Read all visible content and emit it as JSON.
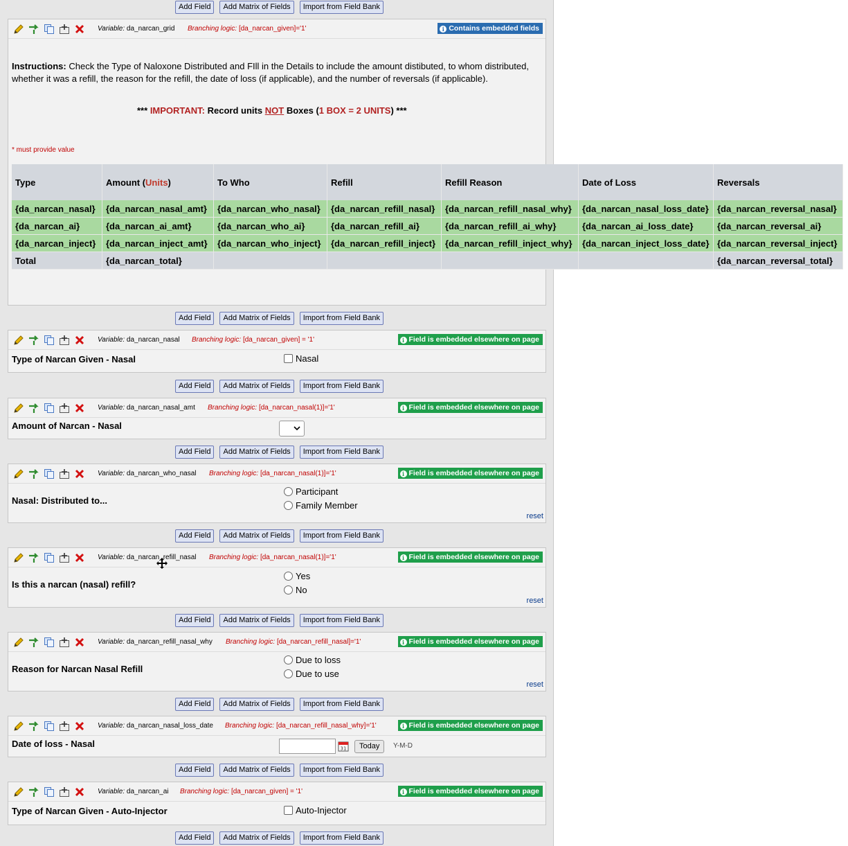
{
  "buttons": {
    "add_field": "Add Field",
    "add_matrix": "Add Matrix of Fields",
    "import": "Import from Field Bank"
  },
  "labels": {
    "variable": "Variable:",
    "branching": "Branching logic:",
    "reset": "reset",
    "today": "Today",
    "date_format": "Y-M-D"
  },
  "badges": {
    "embedded_elsewhere": "Field is embedded elsewhere on page",
    "contains_embedded": "Contains embedded fields"
  },
  "colors": {
    "badge_green": "#1f9f4b",
    "badge_blue": "#2a6cb0",
    "branching_red": "#c00000",
    "matrix_row_green": "#a9d9a0",
    "header_grey": "#d3d7dd"
  },
  "grid": {
    "variable": "da_narcan_grid",
    "branching": "[da_narcan_given]='1'",
    "instructions_bold": "Instructions:",
    "instructions_text": "Check the Type of Naloxone Distributed and FIll in the Details to include the amount distibuted, to whom distributed, whether it was a refill, the reason for the refill,  the date of loss (if applicable), and the number of reversals (if applicable).",
    "important": {
      "stars_left": "***",
      "important": "IMPORTANT:",
      "record_units": "Record units",
      "not": "NOT",
      "boxes": "Boxes (",
      "ratio": "1 BOX = 2 UNITS",
      "close": ")",
      "stars_right": "***"
    },
    "must_provide": "* must provide value",
    "headers": [
      "Type",
      "Amount (",
      "Units",
      ")",
      "To Who",
      "Refill",
      "Refill Reason",
      "Date of Loss",
      "Reversals"
    ],
    "rows": [
      [
        "{da_narcan_nasal}",
        "{da_narcan_nasal_amt}",
        "{da_narcan_who_nasal}",
        "{da_narcan_refill_nasal}",
        "{da_narcan_refill_nasal_why}",
        "{da_narcan_nasal_loss_date}",
        "{da_narcan_reversal_nasal}"
      ],
      [
        "{da_narcan_ai}",
        "{da_narcan_ai_amt}",
        "{da_narcan_who_ai}",
        "{da_narcan_refill_ai}",
        "{da_narcan_refill_ai_why}",
        "{da_narcan_ai_loss_date}",
        "{da_narcan_reversal_ai}"
      ],
      [
        "{da_narcan_inject}",
        "{da_narcan_inject_amt}",
        "{da_narcan_who_inject}",
        "{da_narcan_refill_inject}",
        "{da_narcan_refill_inject_why}",
        "{da_narcan_inject_loss_date}",
        "{da_narcan_reversal_inject}"
      ]
    ],
    "total_row": [
      "Total",
      "{da_narcan_total}",
      "",
      "",
      "",
      "",
      "{da_narcan_reversal_total}"
    ]
  },
  "fields": [
    {
      "variable": "da_narcan_nasal",
      "branching": "[da_narcan_given] = '1'",
      "label": "Type of Narcan Given - Nasal",
      "choices": [
        "Nasal"
      ]
    },
    {
      "variable": "da_narcan_nasal_amt",
      "branching": "[da_narcan_nasal(1)]='1'",
      "label": "Amount of Narcan - Nasal",
      "choices": []
    },
    {
      "variable": "da_narcan_who_nasal",
      "branching": "[da_narcan_nasal(1)]='1'",
      "label": "Nasal: Distributed to...",
      "choices": [
        "Participant",
        "Family Member"
      ]
    },
    {
      "variable": "da_narcan_refill_nasal",
      "branching": "[da_narcan_nasal(1)]='1'",
      "label": "Is this a narcan (nasal) refill?",
      "choices": [
        "Yes",
        "No"
      ]
    },
    {
      "variable": "da_narcan_refill_nasal_why",
      "branching": "[da_narcan_refill_nasal]='1'",
      "label": "Reason for Narcan Nasal Refill",
      "choices": [
        "Due to loss",
        "Due to use"
      ]
    },
    {
      "variable": "da_narcan_nasal_loss_date",
      "branching": "[da_narcan_refill_nasal_why]='1'",
      "label": "Date of loss - Nasal",
      "choices": []
    },
    {
      "variable": "da_narcan_ai",
      "branching": "[da_narcan_given] = '1'",
      "label": "Type of Narcan Given - Auto-Injector",
      "choices": [
        "Auto-Injector"
      ]
    }
  ]
}
